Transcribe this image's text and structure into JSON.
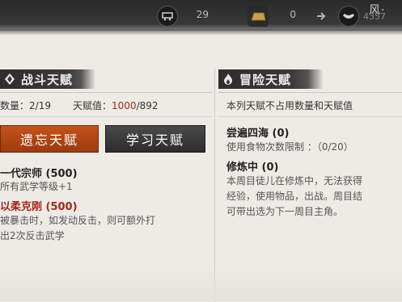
{
  "topbar": {
    "resources": [
      {
        "icon": "cart-icon",
        "value": "29"
      },
      {
        "icon": "gold-bar-icon",
        "value": "0"
      },
      {
        "icon": "silver-ingot-icon",
        "value": "4357"
      }
    ],
    "title_partial": "风·",
    "sub_partial": ""
  },
  "combat": {
    "title": "战斗天赋",
    "count_label": "数量：",
    "count_value": "2/19",
    "talent_label": "天赋值：",
    "talent_used": "1000",
    "talent_total": "/892",
    "forget_button": "遗忘天赋",
    "learn_button": "学习天赋",
    "talents": [
      {
        "name": "一代宗师 (500)",
        "desc": "所有武学等级+1",
        "color": "dark"
      },
      {
        "name": "以柔克刚 (500)",
        "desc": "被暴击时，如发动反击，则可额外打出2次反击武学",
        "desc_line1": "被暴击时，如发动反击，则可额外打",
        "desc_line2": "出2次反击武学",
        "color": "red"
      }
    ]
  },
  "adventure": {
    "title": "冒险天赋",
    "note": "本列天赋不占用数量和天赋值",
    "talents": [
      {
        "name": "尝遍四海 (0)",
        "desc": "使用食物次数限制 ：（0/20）"
      },
      {
        "name": "修炼中 (0)",
        "desc_line1": "本周目徒儿在修炼中，无法获得",
        "desc_line2": "经验，使用物品，出战。周目结",
        "desc_line3": "可带出选为下一周目主角。"
      }
    ]
  }
}
